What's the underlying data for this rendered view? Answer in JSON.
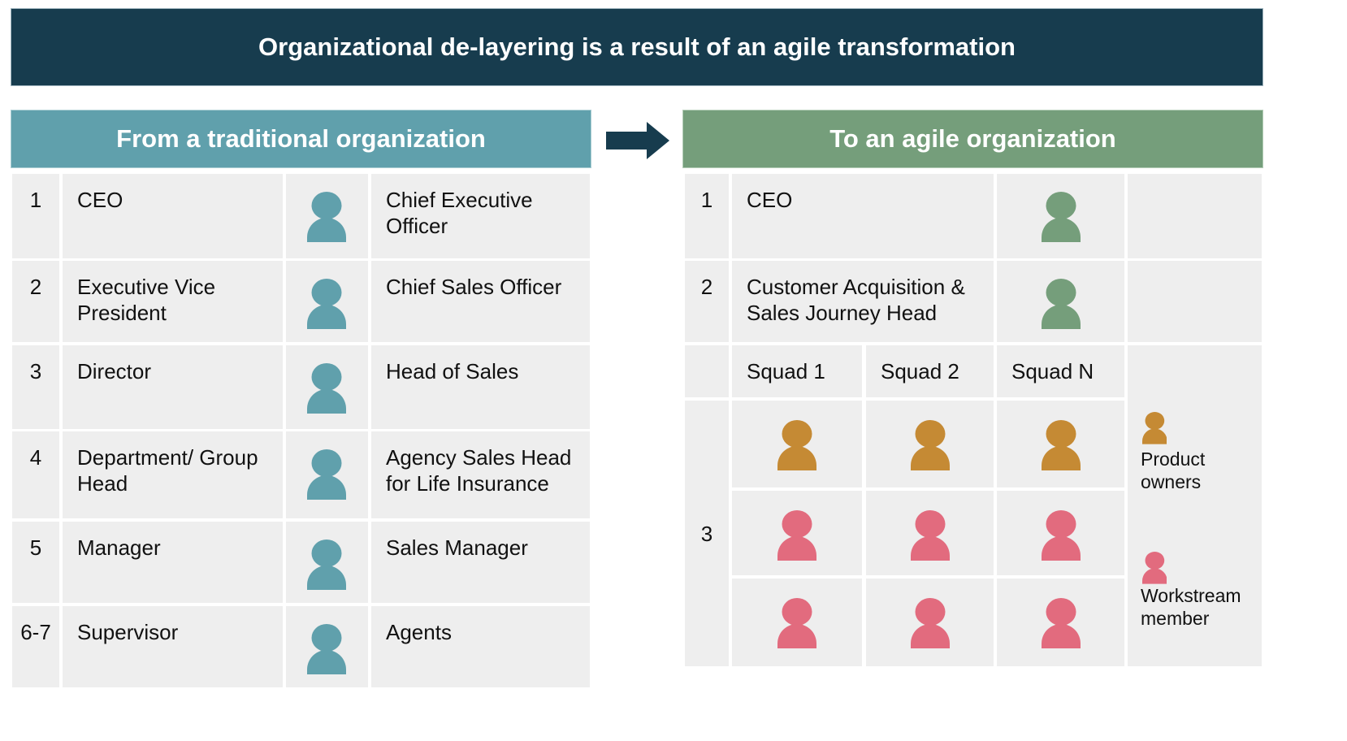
{
  "title": "Organizational de-layering is a result of an agile transformation",
  "colors": {
    "title_bg": "#173c4e",
    "traditional_header": "#60a0ac",
    "agile_header": "#759e7b",
    "traditional_person": "#60a0ac",
    "agile_leader_person": "#759e7b",
    "product_owner_person": "#c58a34",
    "workstream_member_person": "#e26b7e",
    "arrow": "#173c4e",
    "cell_bg": "#eeeeee"
  },
  "traditional": {
    "header": "From a traditional organization",
    "rows": [
      {
        "level": "1",
        "role": "CEO",
        "title": "Chief Executive Officer"
      },
      {
        "level": "2",
        "role": "Executive Vice President",
        "title": "Chief Sales Officer"
      },
      {
        "level": "3",
        "role": "Director",
        "title": "Head of Sales"
      },
      {
        "level": "4",
        "role": "Department/ Group Head",
        "title": "Agency Sales Head for Life Insurance"
      },
      {
        "level": "5",
        "role": "Manager",
        "title": "Sales Manager"
      },
      {
        "level": "6-7",
        "role": "Supervisor",
        "title": "Agents"
      }
    ]
  },
  "agile": {
    "header": "To an agile organization",
    "rows": [
      {
        "level": "1",
        "role": "CEO"
      },
      {
        "level": "2",
        "role": "Customer Acquisition & Sales Journey Head"
      }
    ],
    "squad_level": "3",
    "squads": [
      "Squad 1",
      "Squad 2",
      "Squad N"
    ],
    "squad_rows": [
      "product-owner",
      "workstream-member",
      "workstream-member"
    ],
    "legend": [
      {
        "type": "product-owner",
        "label": "Product owners"
      },
      {
        "type": "workstream-member",
        "label": "Workstream member"
      }
    ]
  }
}
